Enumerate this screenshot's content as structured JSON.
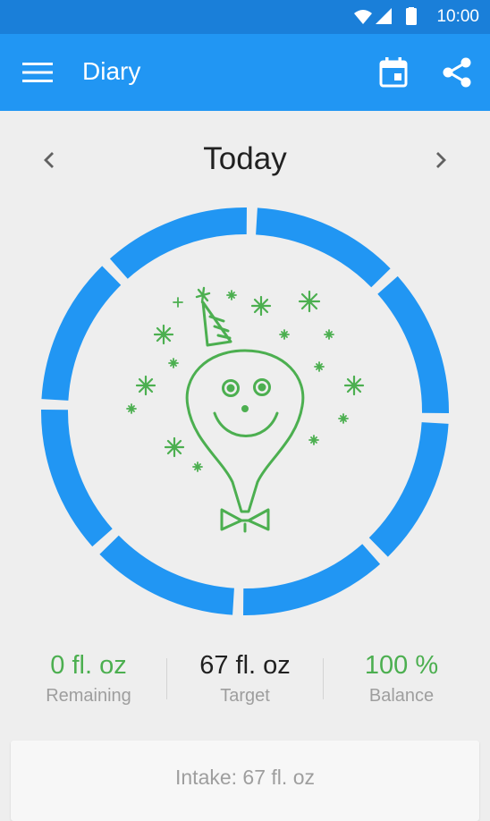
{
  "status_bar": {
    "time": "10:00"
  },
  "app_bar": {
    "title": "Diary",
    "menu_icon": "hamburger-menu-icon",
    "calendar_icon": "calendar-icon",
    "share_icon": "share-icon"
  },
  "date_nav": {
    "label": "Today",
    "prev_icon": "chevron-left-icon",
    "next_icon": "chevron-right-icon"
  },
  "progress": {
    "percent": 100,
    "segments": 8,
    "ring_color": "#2196f3",
    "illustration": "party-balloon-illustration",
    "illustration_color": "#4caf50"
  },
  "stats": {
    "remaining": {
      "value": "0 fl. oz",
      "label": "Remaining",
      "color": "#4caf50"
    },
    "target": {
      "value": "67 fl. oz",
      "label": "Target",
      "color": "#212121"
    },
    "balance": {
      "value": "100 %",
      "label": "Balance",
      "color": "#4caf50"
    }
  },
  "intake": {
    "text": "Intake: 67 fl. oz"
  },
  "colors": {
    "status_bar": "#1a7fd9",
    "app_bar": "#2196f3",
    "background": "#eeeeee",
    "accent_green": "#4caf50"
  }
}
